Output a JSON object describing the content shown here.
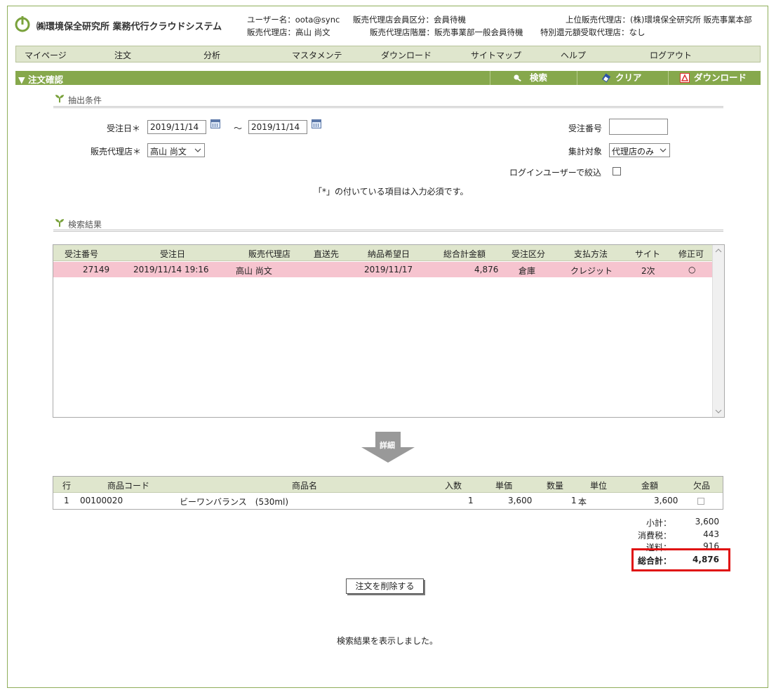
{
  "header": {
    "app_title": "㈱環境保全研究所 業務代行クラウドシステム",
    "user_name": "ユーザー名：oota@sync",
    "agency": "販売代理店：高山 尚文",
    "member_class": "販売代理店会員区分：会員待機",
    "agency_tier": "販売代理店階層：販売事業部一般会員待機",
    "parent_agency": "上位販売代理店：(株)環境保全研究所 販売事業本部",
    "special_rebate": "特別還元額受取代理店：なし"
  },
  "menu": [
    "マイページ",
    "注文",
    "分析",
    "マスタメンテ",
    "ダウンロード",
    "サイトマップ",
    "ヘルプ",
    "ログアウト"
  ],
  "titlebar": {
    "title": "▼ 注文確認",
    "search": "検索",
    "clear": "クリア",
    "download": "ダウンロード"
  },
  "conditions": {
    "heading": "抽出条件",
    "order_date_label": "受注日＊",
    "date_from": "2019/11/14",
    "tilde": "～",
    "date_to": "2019/11/14",
    "agency_label": "販売代理店＊",
    "agency_value": "高山 尚文",
    "order_no_label": "受注番号",
    "order_no_value": "",
    "target_label": "集計対象",
    "target_value": "代理店のみ",
    "login_filter_label": "ログインユーザーで絞込",
    "required_note": "「*」の付いている項目は入力必須です。"
  },
  "results": {
    "heading": "検索結果",
    "columns": [
      "受注番号",
      "受注日",
      "販売代理店",
      "直送先",
      "納品希望日",
      "総合計金額",
      "受注区分",
      "支払方法",
      "サイト",
      "修正可"
    ],
    "rows": [
      [
        "27149",
        "2019/11/14 19:16",
        "高山 尚文",
        "",
        "2019/11/17",
        "4,876",
        "倉庫",
        "クレジット",
        "2次",
        "○"
      ]
    ]
  },
  "detail_arrow_label": "詳細",
  "detail": {
    "columns": [
      "行",
      "商品コード",
      "商品名",
      "入数",
      "単価",
      "数量",
      "単位",
      "金額",
      "欠品"
    ],
    "rows": [
      [
        "1",
        "00100020",
        "ビーワンバランス　(530ml)",
        "1",
        "3,600",
        "1",
        "本",
        "3,600",
        ""
      ]
    ]
  },
  "totals": {
    "subtotal_label": "小計：",
    "subtotal": "3,600",
    "tax_label": "消費税：",
    "tax": "443",
    "shipping_label": "送料：",
    "shipping": "916",
    "grand_label": "総合計：",
    "grand": "4,876"
  },
  "delete_button": "注文を削除する",
  "status_message": "検索結果を表示しました。"
}
